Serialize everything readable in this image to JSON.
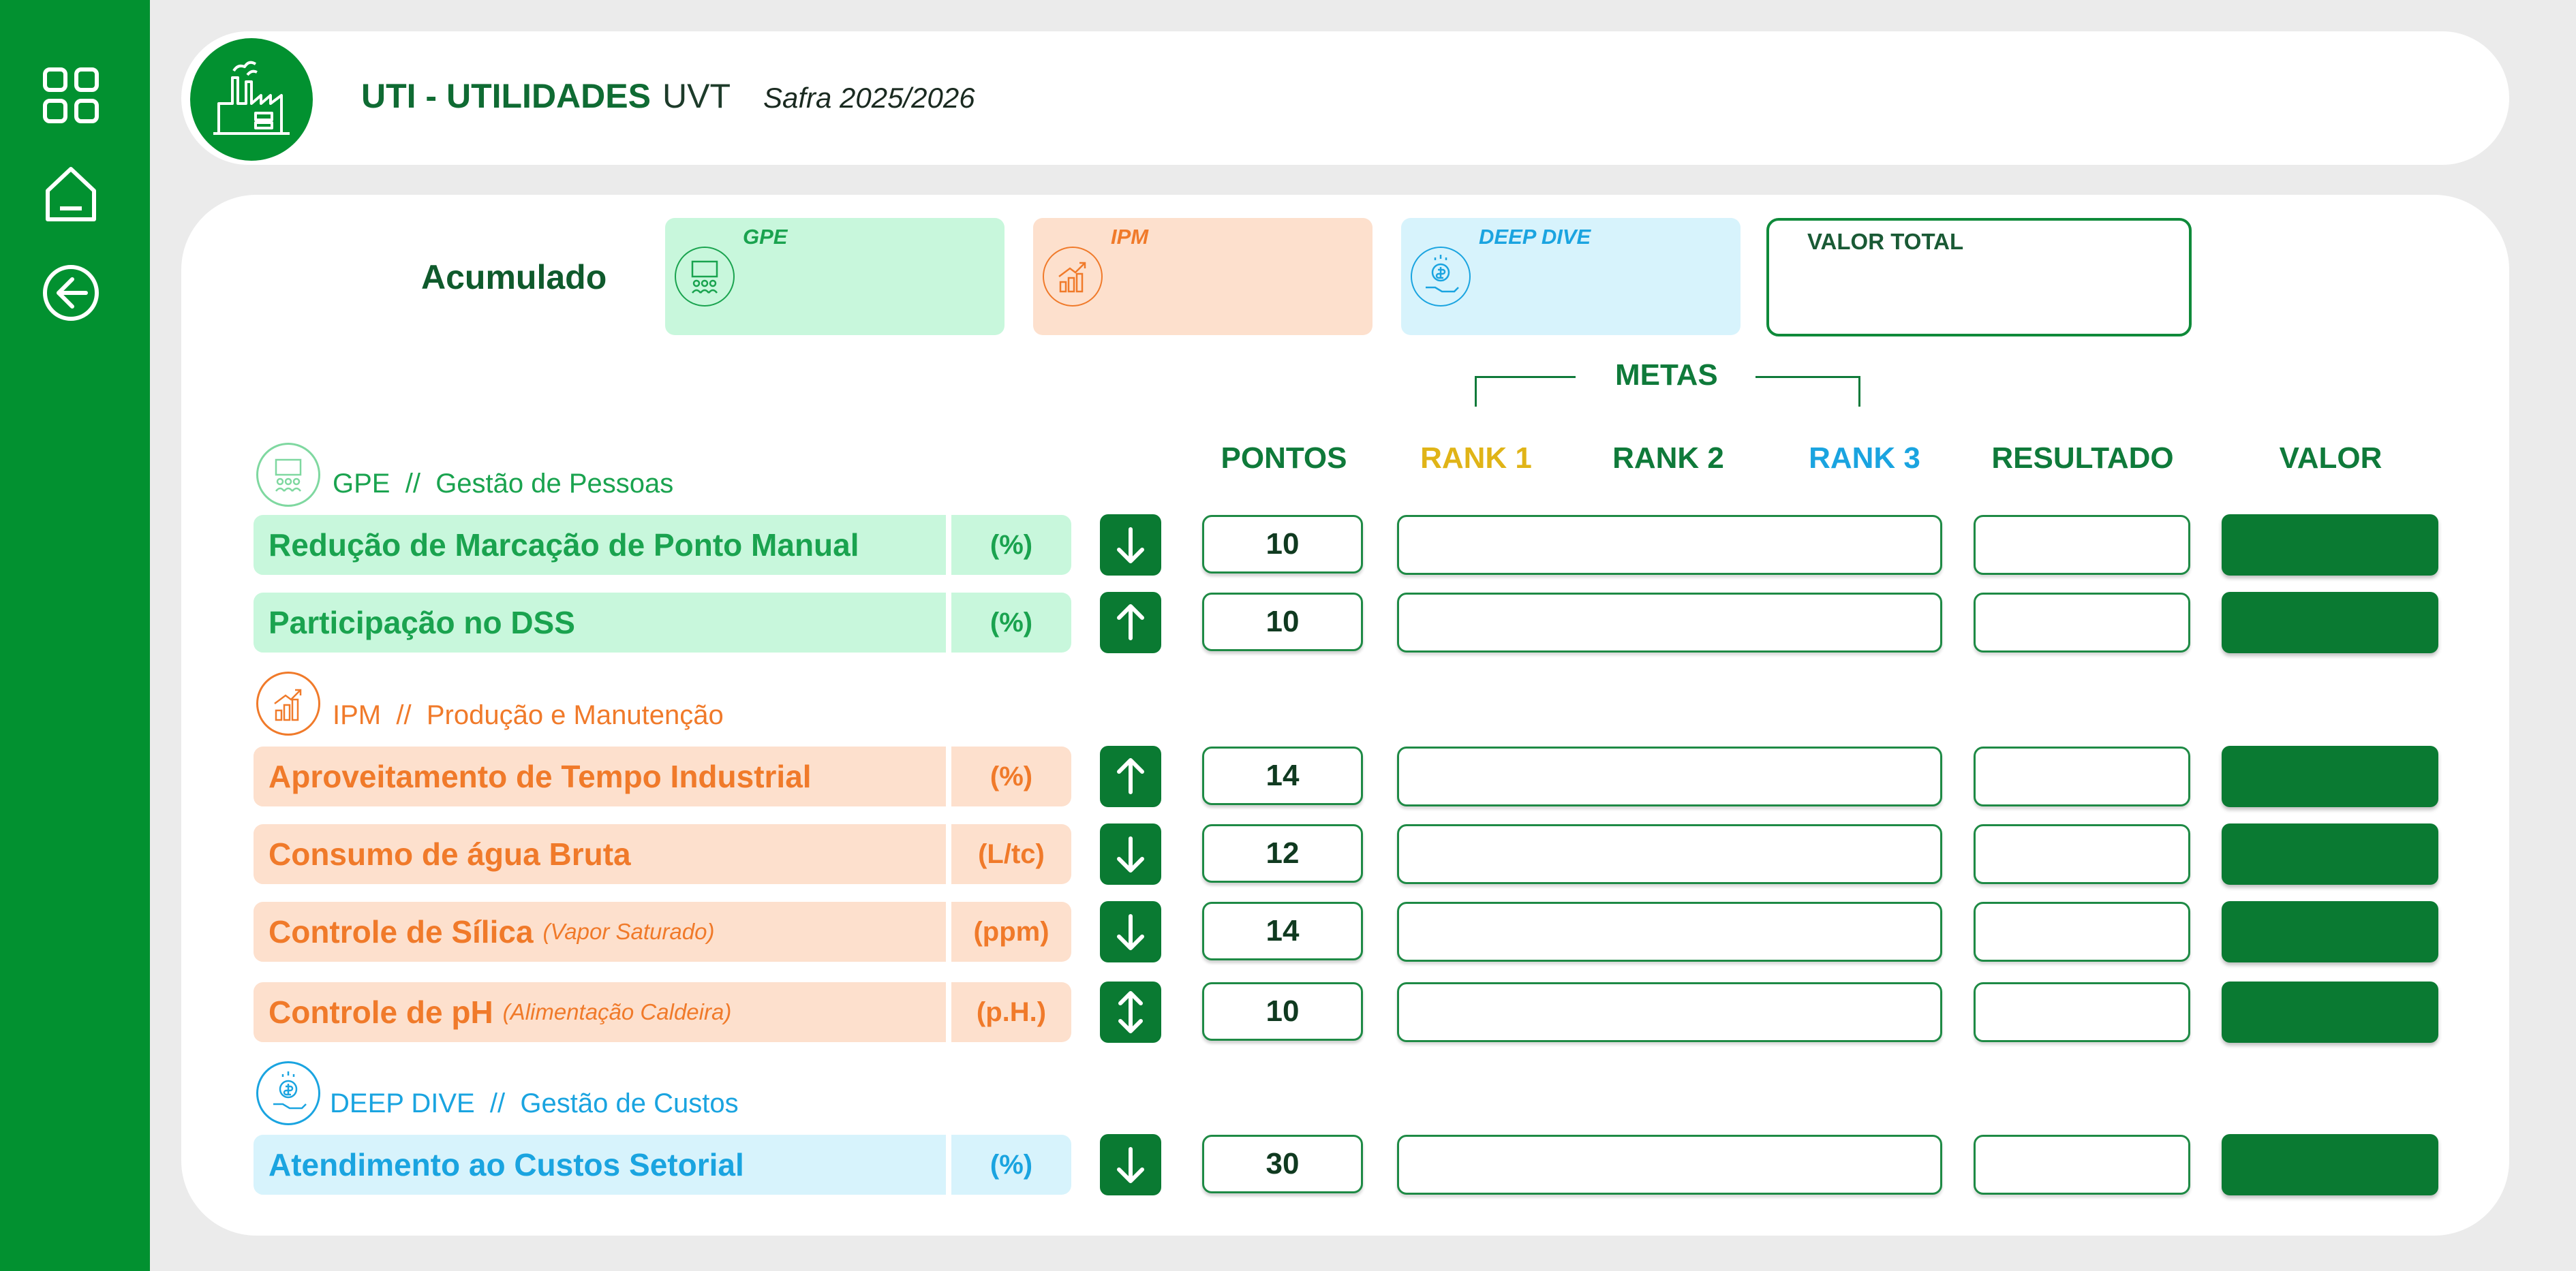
{
  "colors": {
    "green": "#029130",
    "gpe_bg": "#c8f7dc",
    "gpe_text": "#1aa34f",
    "ipm_bg": "#fde0cd",
    "ipm_text": "#f07a2a",
    "deep_bg": "#d7f3fc",
    "deep_text": "#1aa4e0",
    "rank1": "#e0b417",
    "rank3": "#1aa4e0"
  },
  "sidebar": {
    "icons": [
      "grid-icon",
      "home-icon",
      "back-arrow-icon"
    ]
  },
  "header": {
    "title": "UTI - UTILIDADES",
    "unit": "UVT",
    "safra": "Safra 2025/2026",
    "logo_icon": "factory-icon"
  },
  "summary": {
    "acumulado_label": "Acumulado",
    "cards": [
      {
        "label": "GPE",
        "icon": "people-board-icon"
      },
      {
        "label": "IPM",
        "icon": "growth-chart-icon"
      },
      {
        "label": "DEEP DIVE",
        "icon": "money-hand-icon"
      }
    ],
    "total_label": "VALOR TOTAL"
  },
  "metas_label": "METAS",
  "columns": {
    "pontos": "PONTOS",
    "rank1": "RANK 1",
    "rank2": "RANK 2",
    "rank3": "RANK 3",
    "resultado": "RESULTADO",
    "valor": "VALOR"
  },
  "sections": [
    {
      "code": "GPE",
      "sep": "//",
      "name": "Gestão de Pessoas"
    },
    {
      "code": "IPM",
      "sep": "//",
      "name": "Produção e Manutenção"
    },
    {
      "code": "DEEP DIVE",
      "sep": "//",
      "name": "Gestão de Custos"
    }
  ],
  "rows": [
    {
      "label": "Redução de Marcação de Ponto Manual",
      "sub": "",
      "unit": "(%)",
      "direction": "down",
      "pontos": "10"
    },
    {
      "label": "Participação no DSS",
      "sub": "",
      "unit": "(%)",
      "direction": "up",
      "pontos": "10"
    },
    {
      "label": "Aproveitamento de Tempo Industrial",
      "sub": "",
      "unit": "(%)",
      "direction": "up",
      "pontos": "14"
    },
    {
      "label": "Consumo de água Bruta",
      "sub": "",
      "unit": "(L/tc)",
      "direction": "down",
      "pontos": "12"
    },
    {
      "label": "Controle de Sílica",
      "sub": "(Vapor Saturado)",
      "unit": "(ppm)",
      "direction": "down",
      "pontos": "14"
    },
    {
      "label": "Controle de pH",
      "sub": "(Alimentação Caldeira)",
      "unit": "(p.H.)",
      "direction": "up-down",
      "pontos": "10"
    },
    {
      "label": "Atendimento ao Custos Setorial",
      "sub": "",
      "unit": "(%)",
      "direction": "down",
      "pontos": "30"
    }
  ]
}
